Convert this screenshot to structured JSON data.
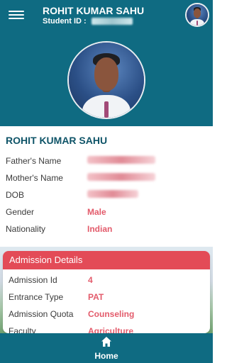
{
  "header": {
    "title": "ROHIT KUMAR SAHU",
    "student_id_label": "Student ID :"
  },
  "profile": {
    "name": "ROHIT KUMAR SAHU",
    "fields": [
      {
        "label": "Father's Name",
        "value": null
      },
      {
        "label": "Mother's Name",
        "value": null
      },
      {
        "label": "DOB",
        "value": null
      },
      {
        "label": "Gender",
        "value": "Male"
      },
      {
        "label": "Nationality",
        "value": "Indian"
      }
    ]
  },
  "admission": {
    "title": "Admission Details",
    "fields": [
      {
        "label": "Admission Id",
        "value": "4"
      },
      {
        "label": "Entrance Type",
        "value": "PAT"
      },
      {
        "label": "Admission Quota",
        "value": "Counseling"
      },
      {
        "label": "Faculty",
        "value": "Agriculture"
      }
    ]
  },
  "bottom_nav": {
    "home_label": "Home"
  },
  "colors": {
    "primary": "#0f6b82",
    "accent": "#e34b57",
    "value_text": "#e35b6b",
    "title_text": "#0f5468"
  }
}
